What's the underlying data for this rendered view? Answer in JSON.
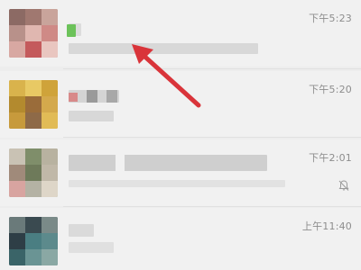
{
  "chats": [
    {
      "time": "下午5:23",
      "muted": false
    },
    {
      "time": "下午5:20",
      "muted": false
    },
    {
      "time": "下午2:01",
      "muted": true
    },
    {
      "time": "上午11:40",
      "muted": false
    }
  ],
  "icons": {
    "mute": "bell-muted-icon",
    "annotation": "red-arrow-icon"
  },
  "colors": {
    "list_background": "#f1f1f1",
    "annotation_arrow": "#d9343a",
    "unread_badge": "#6cc25a"
  }
}
